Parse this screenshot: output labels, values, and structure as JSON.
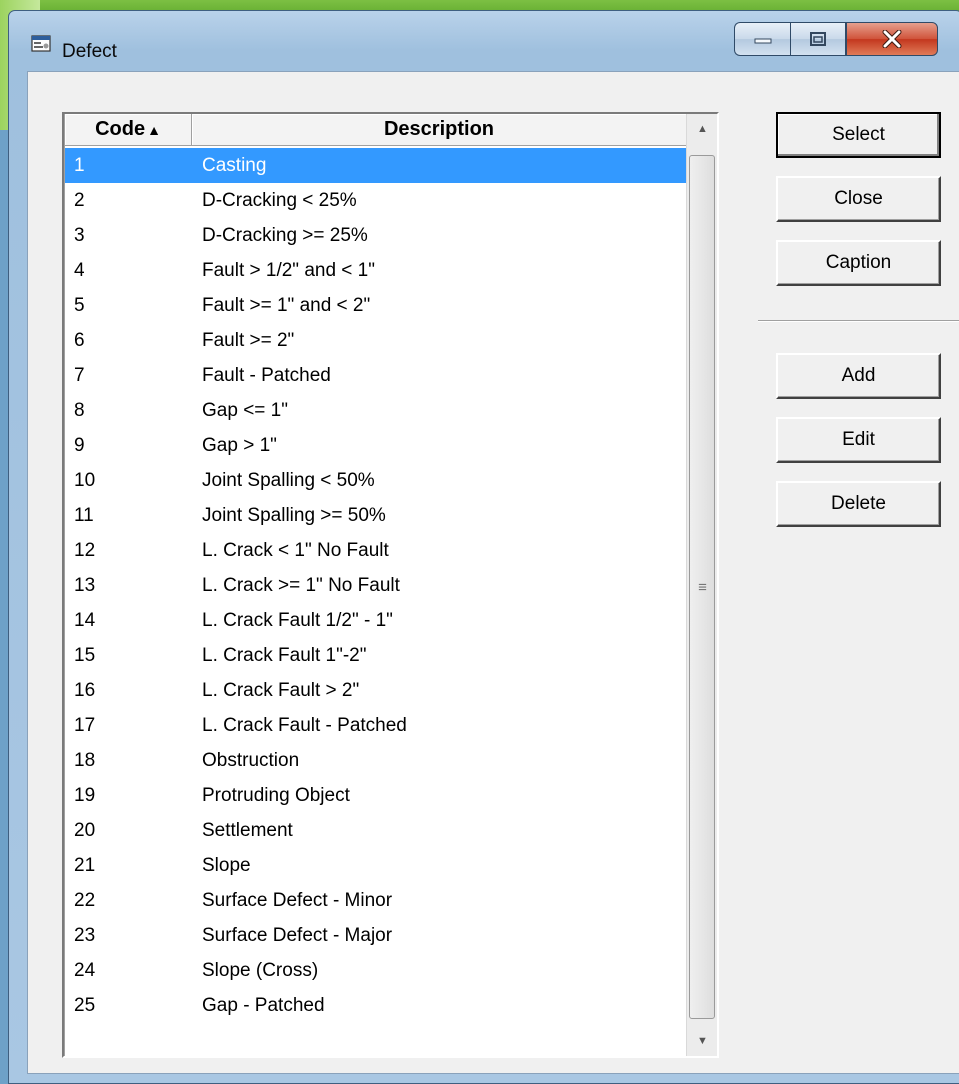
{
  "window": {
    "title": "Defect",
    "icon": "window-app-icon",
    "controls": {
      "minimize_icon": "minimize-icon",
      "maximize_icon": "maximize-icon",
      "close_icon": "close-icon"
    }
  },
  "list": {
    "columns": {
      "code": "Code",
      "description": "Description"
    },
    "sort_indicator": "▲",
    "selected_index": 0,
    "rows": [
      {
        "code": "1",
        "description": "Casting"
      },
      {
        "code": "2",
        "description": "D-Cracking < 25%"
      },
      {
        "code": "3",
        "description": "D-Cracking >= 25%"
      },
      {
        "code": "4",
        "description": "Fault > 1/2\" and < 1\""
      },
      {
        "code": "5",
        "description": "Fault >= 1\" and < 2\""
      },
      {
        "code": "6",
        "description": "Fault >= 2\""
      },
      {
        "code": "7",
        "description": "Fault - Patched"
      },
      {
        "code": "8",
        "description": "Gap <= 1\""
      },
      {
        "code": "9",
        "description": "Gap > 1\""
      },
      {
        "code": "10",
        "description": "Joint Spalling < 50%"
      },
      {
        "code": "11",
        "description": "Joint Spalling >= 50%"
      },
      {
        "code": "12",
        "description": "L. Crack < 1\" No Fault"
      },
      {
        "code": "13",
        "description": "L. Crack >= 1\" No Fault"
      },
      {
        "code": "14",
        "description": "L. Crack Fault 1/2\" - 1\""
      },
      {
        "code": "15",
        "description": "L. Crack Fault 1\"-2\""
      },
      {
        "code": "16",
        "description": "L. Crack Fault > 2\""
      },
      {
        "code": "17",
        "description": "L. Crack Fault - Patched"
      },
      {
        "code": "18",
        "description": "Obstruction"
      },
      {
        "code": "19",
        "description": "Protruding Object"
      },
      {
        "code": "20",
        "description": "Settlement"
      },
      {
        "code": "21",
        "description": "Slope"
      },
      {
        "code": "22",
        "description": "Surface Defect - Minor"
      },
      {
        "code": "23",
        "description": "Surface Defect - Major"
      },
      {
        "code": "24",
        "description": "Slope (Cross)"
      },
      {
        "code": "25",
        "description": "Gap - Patched"
      }
    ]
  },
  "buttons": {
    "select": "Select",
    "close": "Close",
    "caption": "Caption",
    "add": "Add",
    "edit": "Edit",
    "delete": "Delete"
  },
  "colors": {
    "selection": "#3399ff",
    "window_frame": "#a9c7e3",
    "close_button": "#c3371e"
  }
}
